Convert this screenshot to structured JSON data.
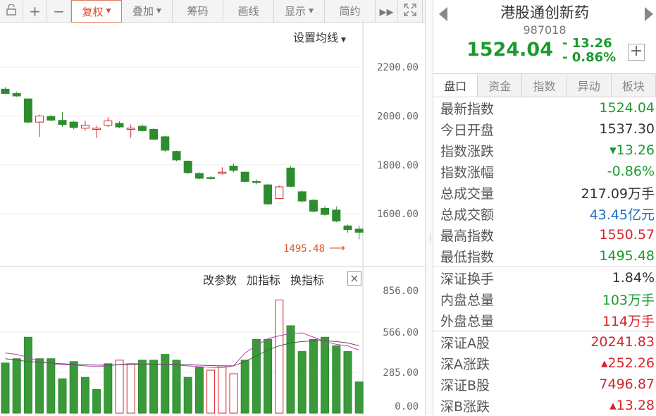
{
  "toolbar": {
    "items": [
      {
        "label": "",
        "icon": "lock-icon"
      },
      {
        "label": "+",
        "icon": "zoom-in-icon"
      },
      {
        "label": "−",
        "icon": "zoom-out-icon"
      },
      {
        "label": "复权",
        "active": true,
        "dropdown": true
      },
      {
        "label": "叠加",
        "dropdown": true
      },
      {
        "label": "筹码"
      },
      {
        "label": "画线"
      },
      {
        "label": "显示",
        "dropdown": true
      },
      {
        "label": "简约"
      },
      {
        "label": "▸▸",
        "icon": "fast-forward-icon"
      },
      {
        "label": "",
        "icon": "fullscreen-icon"
      }
    ]
  },
  "chart": {
    "ma_setting": "设置均线",
    "price_ticks": [
      "2200.00",
      "2000.00",
      "1800.00",
      "1600.00"
    ],
    "low_label": "1495.48",
    "indicator_buttons": [
      "改参数",
      "加指标",
      "换指标"
    ],
    "close_label": "×",
    "volume_ticks": [
      "856.00",
      "566.00",
      "285.00",
      "0.00"
    ]
  },
  "chart_data": {
    "type": "candlestick",
    "ylim": [
      1430,
      2290
    ],
    "candles": [
      {
        "o": 2110,
        "c": 2092,
        "h": 2118,
        "l": 2090
      },
      {
        "o": 2092,
        "c": 2082,
        "h": 2100,
        "l": 2078
      },
      {
        "o": 2070,
        "c": 1975,
        "h": 2072,
        "l": 1970
      },
      {
        "o": 1975,
        "c": 2000,
        "h": 2005,
        "l": 1915
      },
      {
        "o": 1998,
        "c": 1983,
        "h": 2005,
        "l": 1978
      },
      {
        "o": 1982,
        "c": 1965,
        "h": 2015,
        "l": 1955
      },
      {
        "o": 1975,
        "c": 1953,
        "h": 1980,
        "l": 1945
      },
      {
        "o": 1950,
        "c": 1962,
        "h": 1980,
        "l": 1940
      },
      {
        "o": 1945,
        "c": 1950,
        "h": 1960,
        "l": 1910
      },
      {
        "o": 1962,
        "c": 1980,
        "h": 1995,
        "l": 1955
      },
      {
        "o": 1970,
        "c": 1955,
        "h": 1978,
        "l": 1950
      },
      {
        "o": 1945,
        "c": 1950,
        "h": 1965,
        "l": 1910
      },
      {
        "o": 1958,
        "c": 1940,
        "h": 1965,
        "l": 1935
      },
      {
        "o": 1945,
        "c": 1905,
        "h": 1952,
        "l": 1900
      },
      {
        "o": 1915,
        "c": 1860,
        "h": 1918,
        "l": 1852
      },
      {
        "o": 1855,
        "c": 1820,
        "h": 1858,
        "l": 1815
      },
      {
        "o": 1815,
        "c": 1768,
        "h": 1818,
        "l": 1762
      },
      {
        "o": 1765,
        "c": 1745,
        "h": 1770,
        "l": 1740
      },
      {
        "o": 1748,
        "c": 1745,
        "h": 1755,
        "l": 1740
      },
      {
        "o": 1765,
        "c": 1770,
        "h": 1790,
        "l": 1760
      },
      {
        "o": 1795,
        "c": 1778,
        "h": 1805,
        "l": 1770
      },
      {
        "o": 1770,
        "c": 1732,
        "h": 1772,
        "l": 1728
      },
      {
        "o": 1732,
        "c": 1728,
        "h": 1740,
        "l": 1720
      },
      {
        "o": 1718,
        "c": 1640,
        "h": 1722,
        "l": 1636
      },
      {
        "o": 1662,
        "c": 1710,
        "h": 1715,
        "l": 1660
      },
      {
        "o": 1787,
        "c": 1712,
        "h": 1795,
        "l": 1708
      },
      {
        "o": 1690,
        "c": 1652,
        "h": 1695,
        "l": 1645
      },
      {
        "o": 1655,
        "c": 1610,
        "h": 1660,
        "l": 1605
      },
      {
        "o": 1622,
        "c": 1597,
        "h": 1632,
        "l": 1592
      },
      {
        "o": 1615,
        "c": 1570,
        "h": 1630,
        "l": 1565
      },
      {
        "o": 1550,
        "c": 1535,
        "h": 1555,
        "l": 1522
      },
      {
        "o": 1537,
        "c": 1524,
        "h": 1550,
        "l": 1495
      }
    ],
    "volume_ylim": [
      0,
      856
    ],
    "volumes": [
      {
        "v": 350,
        "up": false
      },
      {
        "v": 380,
        "up": false
      },
      {
        "v": 530,
        "up": false
      },
      {
        "v": 380,
        "up": false
      },
      {
        "v": 380,
        "up": false
      },
      {
        "v": 240,
        "up": false
      },
      {
        "v": 360,
        "up": false
      },
      {
        "v": 250,
        "up": false
      },
      {
        "v": 165,
        "up": false
      },
      {
        "v": 345,
        "up": false
      },
      {
        "v": 370,
        "up": true
      },
      {
        "v": 345,
        "up": true
      },
      {
        "v": 370,
        "up": false
      },
      {
        "v": 370,
        "up": false
      },
      {
        "v": 410,
        "up": false
      },
      {
        "v": 370,
        "up": false
      },
      {
        "v": 250,
        "up": false
      },
      {
        "v": 320,
        "up": false
      },
      {
        "v": 300,
        "up": true
      },
      {
        "v": 330,
        "up": true
      },
      {
        "v": 275,
        "up": true
      },
      {
        "v": 370,
        "up": false
      },
      {
        "v": 515,
        "up": false
      },
      {
        "v": 515,
        "up": false
      },
      {
        "v": 790,
        "up": true
      },
      {
        "v": 610,
        "up": false
      },
      {
        "v": 430,
        "up": false
      },
      {
        "v": 515,
        "up": false
      },
      {
        "v": 530,
        "up": false
      },
      {
        "v": 470,
        "up": false
      },
      {
        "v": 430,
        "up": false
      },
      {
        "v": 218,
        "up": false
      }
    ],
    "ma5": [
      420,
      410,
      390,
      360,
      345,
      340,
      335,
      330,
      325,
      330,
      340,
      345,
      345,
      345,
      340,
      335,
      330,
      325,
      320,
      318,
      330,
      420,
      470,
      520,
      540,
      555,
      560,
      530,
      500,
      480,
      470,
      440
    ],
    "ma10": [
      380,
      370,
      360,
      355,
      350,
      345,
      340,
      338,
      335,
      335,
      338,
      340,
      340,
      342,
      342,
      340,
      338,
      335,
      332,
      330,
      330,
      360,
      400,
      440,
      470,
      490,
      500,
      505,
      505,
      500,
      490,
      470
    ]
  },
  "panel": {
    "title": "港股通创新药",
    "code": "987018",
    "price": "1524.04",
    "change": "- 13.26",
    "change_pct": "- 0.86%",
    "plus": "+",
    "tabs": [
      "盘口",
      "资金",
      "指数",
      "异动",
      "板块"
    ],
    "rows": [
      {
        "k": "最新指数",
        "v": "1524.04",
        "c": "#1a9b2c"
      },
      {
        "k": "今日开盘",
        "v": "1537.30",
        "c": "#333333"
      },
      {
        "k": "指数涨跌",
        "v": "▾13.26",
        "c": "#1a9b2c"
      },
      {
        "k": "指数涨幅",
        "v": "-0.86%",
        "c": "#1a9b2c"
      },
      {
        "k": "总成交量",
        "v": "217.09万手",
        "c": "#333333"
      },
      {
        "k": "总成交额",
        "v": "43.45亿元",
        "c": "#1b6fc8"
      },
      {
        "k": "最高指数",
        "v": "1550.57",
        "c": "#d8232a"
      },
      {
        "k": "最低指数",
        "v": "1495.48",
        "c": "#1a9b2c"
      },
      {
        "k": "深证换手",
        "v": "1.84%",
        "c": "#333333",
        "sep": true
      },
      {
        "k": "内盘总量",
        "v": "103万手",
        "c": "#1a9b2c"
      },
      {
        "k": "外盘总量",
        "v": "114万手",
        "c": "#d8232a"
      },
      {
        "k": "深证A股",
        "v": "20241.83",
        "c": "#d8232a",
        "sep": true
      },
      {
        "k": "深A涨跌",
        "v": "▴252.26",
        "c": "#d8232a"
      },
      {
        "k": "深证B股",
        "v": "7496.87",
        "c": "#d8232a"
      },
      {
        "k": "深B涨跌",
        "v": "▴13.28",
        "c": "#d8232a"
      }
    ]
  }
}
